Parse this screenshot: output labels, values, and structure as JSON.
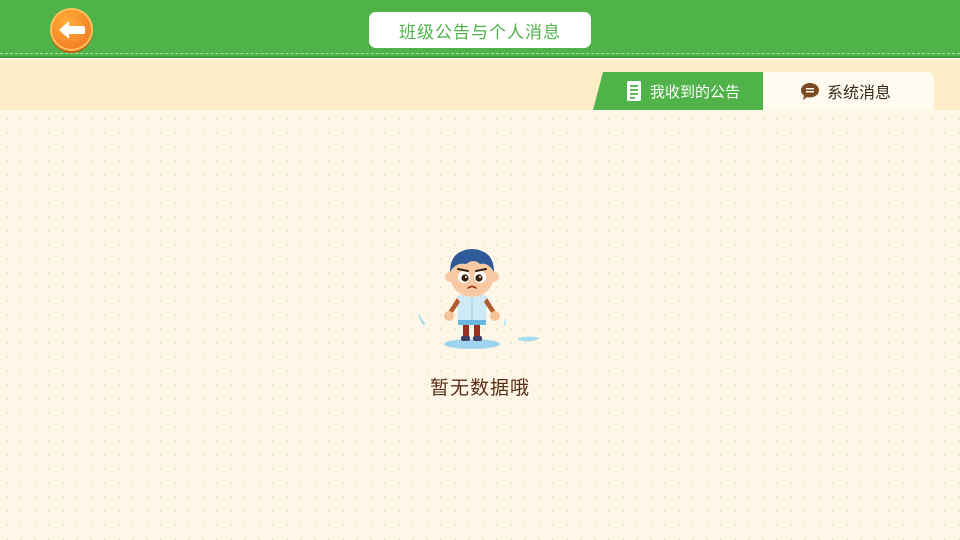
{
  "header": {
    "title": "班级公告与个人消息",
    "back_icon": "back-arrow-icon"
  },
  "tabs": [
    {
      "label": "我收到的公告",
      "icon": "document-icon",
      "active": true
    },
    {
      "label": "系统消息",
      "icon": "chat-bubble-icon",
      "active": false
    }
  ],
  "empty_state": {
    "message": "暂无数据哦",
    "illustration": "cartoon-boy-illustration"
  },
  "colors": {
    "primary_green": "#4fb34a",
    "back_button_orange": "#f7892a",
    "background_cream": "#fef7e7",
    "tabstrip_bg": "#fdedc6",
    "empty_text_brown": "#5a2f16"
  }
}
